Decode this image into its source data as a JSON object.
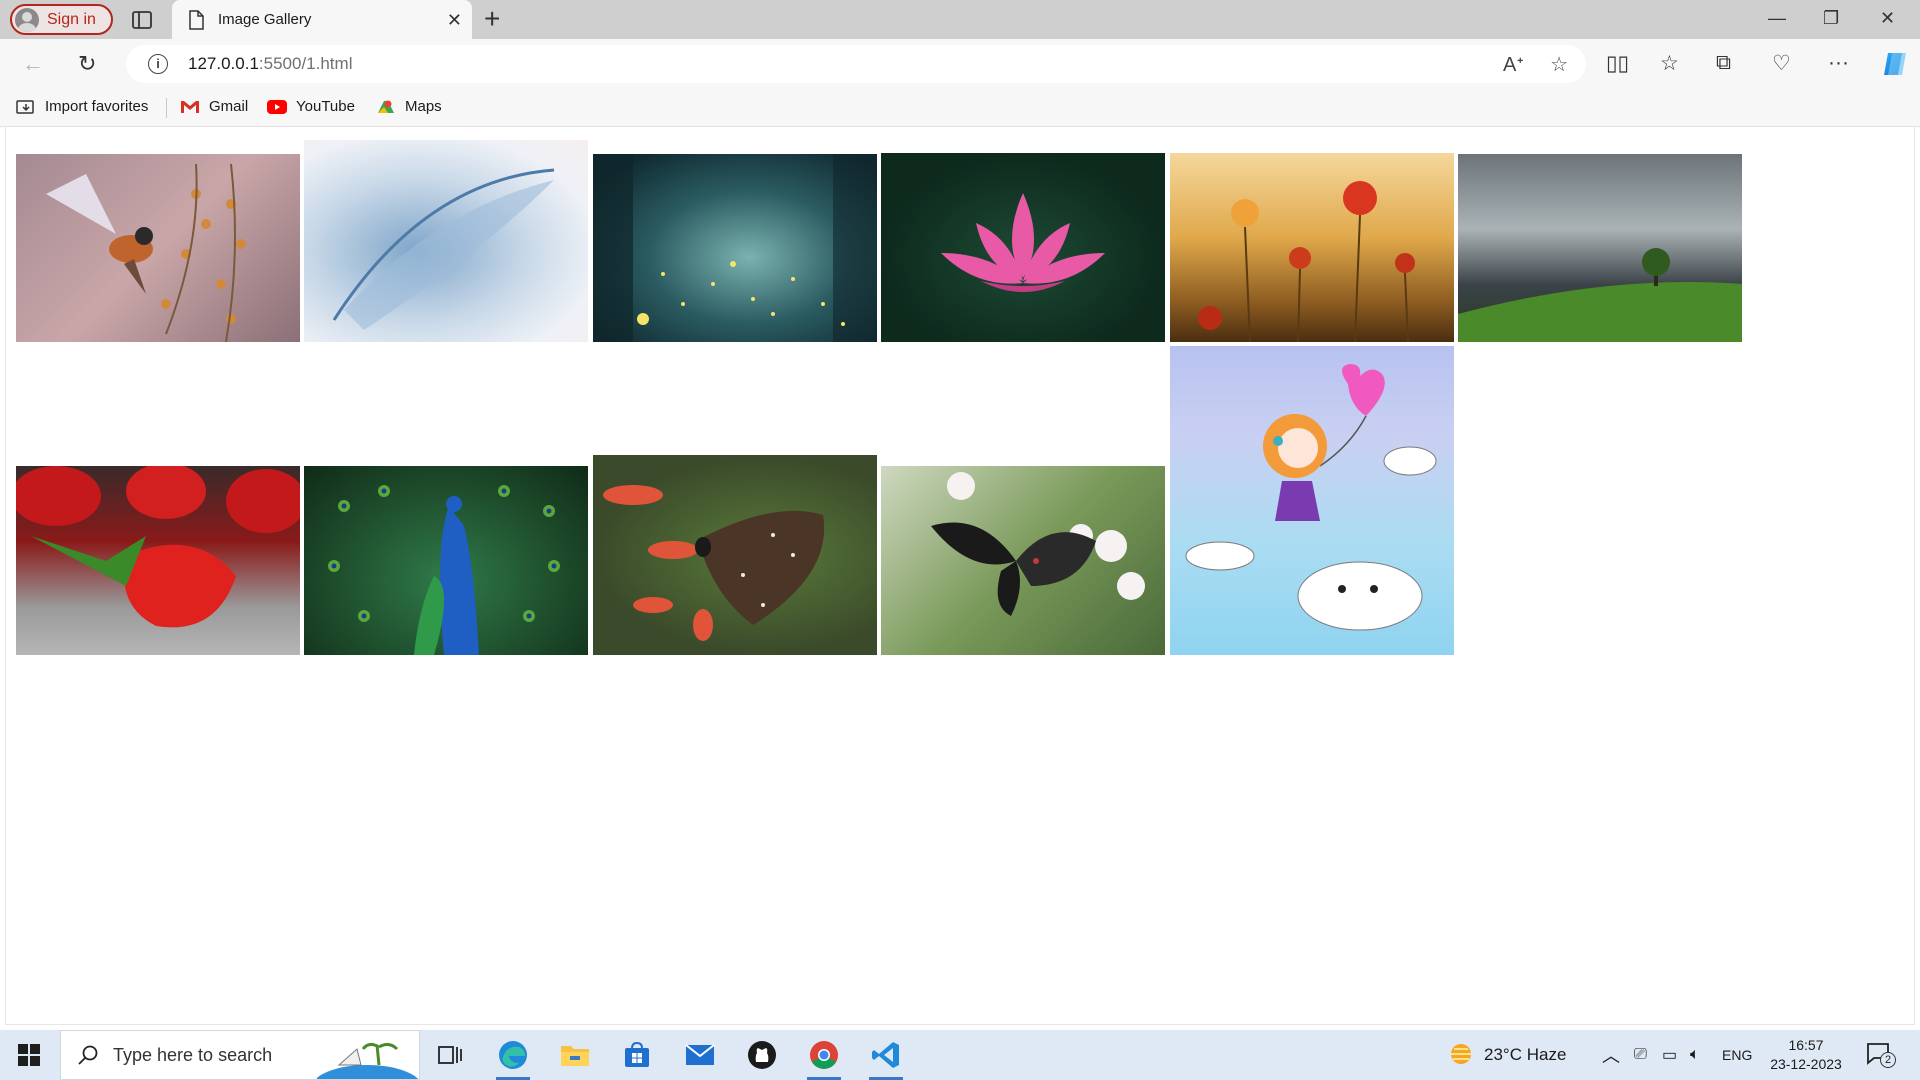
{
  "browser": {
    "sign_in_label": "Sign in",
    "tab": {
      "title": "Image Gallery"
    },
    "address": {
      "host": "127.0.0.1",
      "path": ":5500/1.html"
    },
    "favorites": [
      {
        "label": "Import favorites",
        "icon": "import-favorites-icon"
      },
      {
        "label": "Gmail",
        "icon": "gmail-icon"
      },
      {
        "label": "YouTube",
        "icon": "youtube-icon"
      },
      {
        "label": "Maps",
        "icon": "maps-icon"
      }
    ]
  },
  "gallery": {
    "images": [
      {
        "subject": "bird-with-flowers"
      },
      {
        "subject": "blue-feather"
      },
      {
        "subject": "fireflies-forest"
      },
      {
        "subject": "pink-lotus"
      },
      {
        "subject": "poppy-field"
      },
      {
        "subject": "tree-on-hill-storm"
      },
      {
        "subject": "strawberries"
      },
      {
        "subject": "peacock"
      },
      {
        "subject": "butterfly-red-flowers"
      },
      {
        "subject": "butterfly-white-flowers"
      },
      {
        "subject": "cartoon-girl-balloon"
      }
    ]
  },
  "taskbar": {
    "search_placeholder": "Type here to search",
    "weather": "23°C  Haze",
    "language": "ENG",
    "time": "16:57",
    "date": "23-12-2023",
    "notification_count": "2"
  }
}
